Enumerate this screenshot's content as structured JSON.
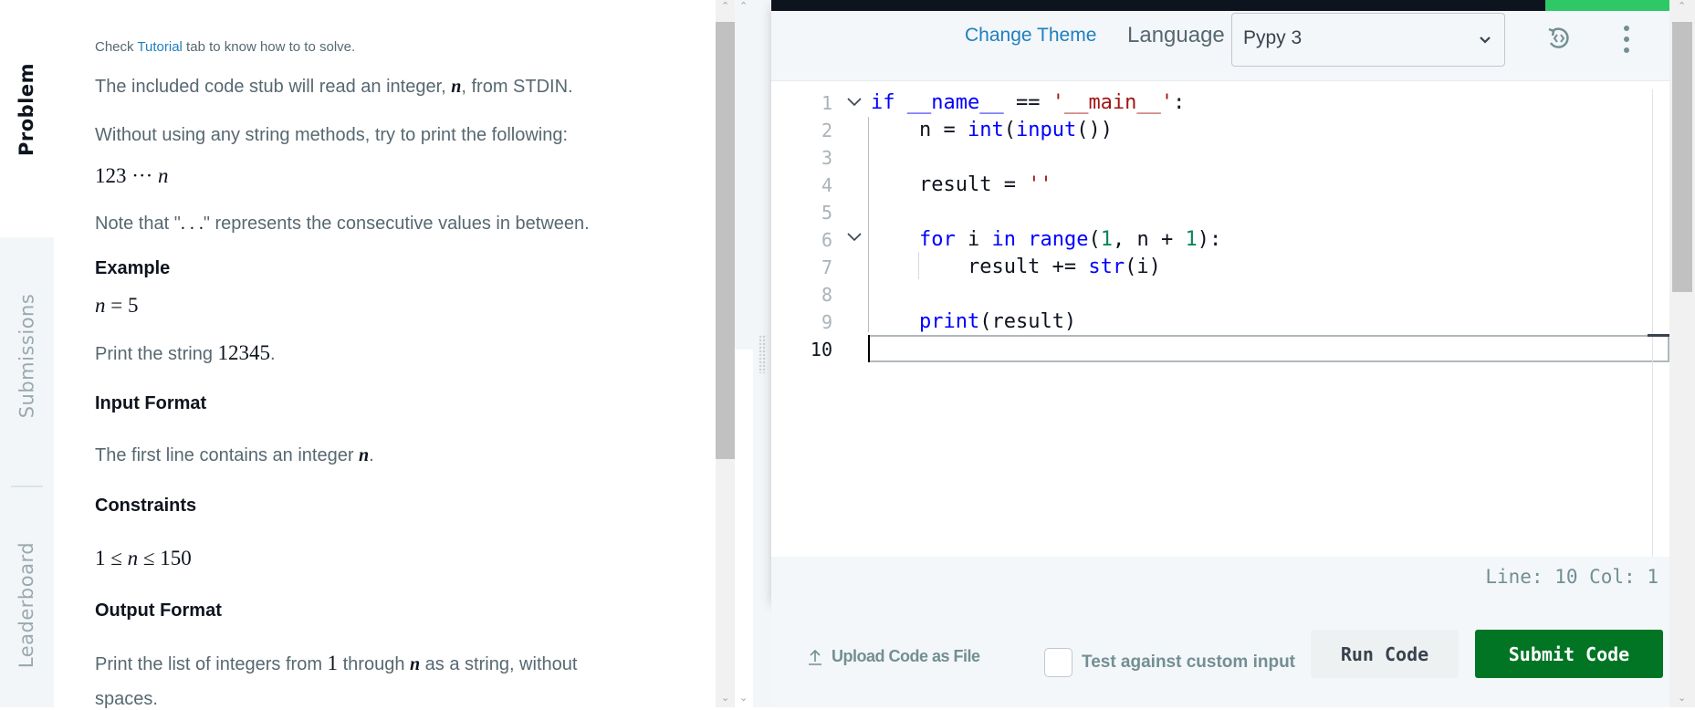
{
  "tabs": {
    "problem": "Problem",
    "submissions": "Submissions",
    "leaderboard": "Leaderboard"
  },
  "problem": {
    "hint_prefix": "Check ",
    "hint_link": "Tutorial",
    "hint_suffix": " tab to know how to to solve.",
    "p1_a": "The included code stub will read an integer, ",
    "p1_var": "n",
    "p1_b": ", from STDIN.",
    "p2": "Without using any string methods, try to print the following:",
    "formula": "123 ··· ",
    "formula_var": "n",
    "note_a": "Note that \"",
    "note_dots": ". . .",
    "note_b": "\" represents the consecutive values in between.",
    "example_heading": "Example",
    "example_var": "n",
    "example_eq": " = 5",
    "print_a": "Print the string ",
    "print_val": "12345",
    "print_b": ".",
    "input_heading": "Input Format",
    "input_a": "The first line contains an integer ",
    "input_var": "n",
    "input_b": ".",
    "constraints_heading": "Constraints",
    "constraint_a": "1 ≤ ",
    "constraint_var": "n",
    "constraint_b": " ≤ 150",
    "output_heading": "Output Format",
    "output_a": "Print the list of integers from ",
    "output_one": "1",
    "output_b": " through ",
    "output_var": "n",
    "output_c": " as a string, without",
    "output_d": "spaces."
  },
  "editor": {
    "change_theme": "Change Theme",
    "language_label": "Language",
    "language_value": "Pypy 3",
    "line_numbers": [
      "1",
      "2",
      "3",
      "4",
      "5",
      "6",
      "7",
      "8",
      "9",
      "10"
    ],
    "code": {
      "l1": [
        {
          "t": "if",
          "c": "kw"
        },
        {
          "t": " ",
          "c": "tx"
        },
        {
          "t": "__name__",
          "c": "kw"
        },
        {
          "t": " == ",
          "c": "tx"
        },
        {
          "t": "'__main__'",
          "c": "st"
        },
        {
          "t": ":",
          "c": "tx"
        }
      ],
      "l2": [
        {
          "t": "    n = ",
          "c": "tx"
        },
        {
          "t": "int",
          "c": "kw"
        },
        {
          "t": "(",
          "c": "tx"
        },
        {
          "t": "input",
          "c": "kw"
        },
        {
          "t": "())",
          "c": "tx"
        }
      ],
      "l4": [
        {
          "t": "    result = ",
          "c": "tx"
        },
        {
          "t": "''",
          "c": "st"
        }
      ],
      "l6": [
        {
          "t": "    ",
          "c": "tx"
        },
        {
          "t": "for",
          "c": "kw"
        },
        {
          "t": " i ",
          "c": "tx"
        },
        {
          "t": "in",
          "c": "kw"
        },
        {
          "t": " ",
          "c": "tx"
        },
        {
          "t": "range",
          "c": "kw"
        },
        {
          "t": "(",
          "c": "tx"
        },
        {
          "t": "1",
          "c": "nm"
        },
        {
          "t": ", n + ",
          "c": "tx"
        },
        {
          "t": "1",
          "c": "nm"
        },
        {
          "t": "):",
          "c": "tx"
        }
      ],
      "l7": [
        {
          "t": "        result += ",
          "c": "tx"
        },
        {
          "t": "str",
          "c": "kw"
        },
        {
          "t": "(i)",
          "c": "tx"
        }
      ],
      "l9": [
        {
          "t": "    ",
          "c": "tx"
        },
        {
          "t": "print",
          "c": "kw"
        },
        {
          "t": "(result)",
          "c": "tx"
        }
      ]
    },
    "status": "Line: 10 Col: 1"
  },
  "actions": {
    "upload": "Upload Code as File",
    "custom_input": "Test against custom input",
    "custom_input_checked": false,
    "run": "Run Code",
    "submit": "Submit Code"
  },
  "colors": {
    "accent_link": "#1f7fbf",
    "submit_bg": "#027524",
    "top_green": "#2ec866",
    "dark_bar": "#0e141e"
  }
}
